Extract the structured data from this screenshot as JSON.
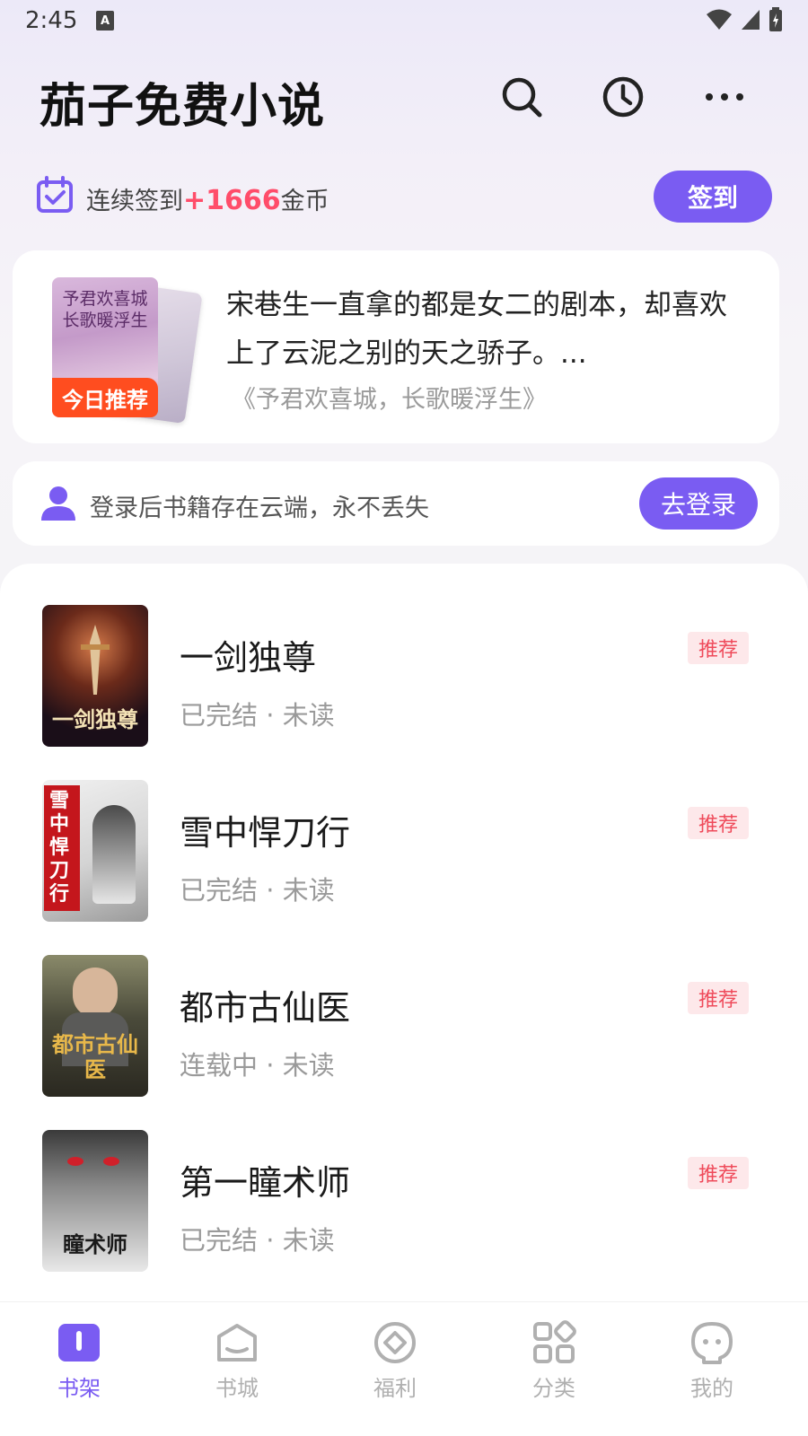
{
  "status_bar": {
    "time": "2:45",
    "notification_glyph": "A"
  },
  "header": {
    "title": "茄子免费小说"
  },
  "checkin": {
    "text_prefix": "连续签到",
    "coins": "+1666",
    "text_suffix": "金币",
    "button_label": "签到"
  },
  "recommendation": {
    "cover_title": "予君欢喜城 长歌暖浮生",
    "badge": "今日推荐",
    "description": "宋巷生一直拿的都是女二的剧本，却喜欢上了云泥之别的天之骄子。...",
    "source": "《予君欢喜城，长歌暖浮生》"
  },
  "login": {
    "text": "登录后书籍存在云端，永不丢失",
    "button_label": "去登录"
  },
  "books": [
    {
      "title": "一剑独尊",
      "status": "已完结 · 未读",
      "tag": "推荐",
      "cover_text": "一剑独尊"
    },
    {
      "title": "雪中悍刀行",
      "status": "已完结 · 未读",
      "tag": "推荐",
      "cover_text": "雪中悍刀行"
    },
    {
      "title": "都市古仙医",
      "status": "连载中 · 未读",
      "tag": "推荐",
      "cover_text": "都市古仙医"
    },
    {
      "title": "第一瞳术师",
      "status": "已完结 · 未读",
      "tag": "推荐",
      "cover_text": "瞳术师"
    }
  ],
  "bottom_nav": [
    {
      "label": "书架",
      "icon": "bookshelf-icon",
      "active": true
    },
    {
      "label": "书城",
      "icon": "bookstore-icon",
      "active": false
    },
    {
      "label": "福利",
      "icon": "welfare-icon",
      "active": false
    },
    {
      "label": "分类",
      "icon": "category-icon",
      "active": false
    },
    {
      "label": "我的",
      "icon": "profile-icon",
      "active": false
    }
  ],
  "colors": {
    "accent": "#7a5cf2",
    "coins": "#ff4d6a",
    "badge": "#ff4d1f",
    "tag_text": "#ef4b5b",
    "tag_bg": "#fde8ea"
  }
}
